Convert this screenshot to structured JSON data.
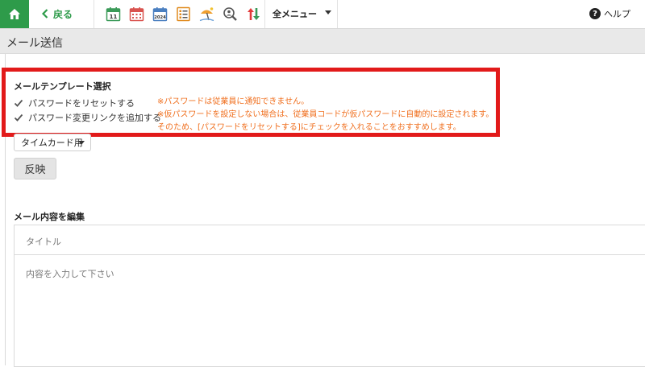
{
  "toolbar": {
    "back_label": "戻る",
    "menu_label": "全メニュー",
    "help_label": "ヘルプ",
    "help_symbol": "?",
    "icons": [
      "calendar-11-icon",
      "calendar-month-icon",
      "calendar-2024-icon",
      "list-icon",
      "vacation-icon",
      "search-person-icon",
      "sort-arrows-icon"
    ],
    "icon_text": {
      "calendar_day": "11",
      "calendar_year": "2024"
    }
  },
  "page": {
    "title": "メール送信"
  },
  "template_section": {
    "title": "メールテンプレート選択",
    "checkboxes": [
      {
        "label": "パスワードをリセットする",
        "checked": true
      },
      {
        "label": "パスワード変更リンクを追加する",
        "checked": true
      }
    ],
    "notes": [
      "※パスワードは従業員に通知できません。",
      "※仮パスワードを設定しない場合は、従業員コードが仮パスワードに自動的に設定されます。",
      "そのため、[パスワードをリセットする]にチェックを入れることをおすすめします。"
    ],
    "template_select": "タイムカード用",
    "apply_label": "反映"
  },
  "edit_section": {
    "title": "メール内容を編集",
    "title_placeholder": "タイトル",
    "body_placeholder": "内容を入力して下さい"
  },
  "colors": {
    "brand_green": "#2e9b4a",
    "highlight_red": "#e21a1a",
    "note_orange": "#f07020"
  }
}
